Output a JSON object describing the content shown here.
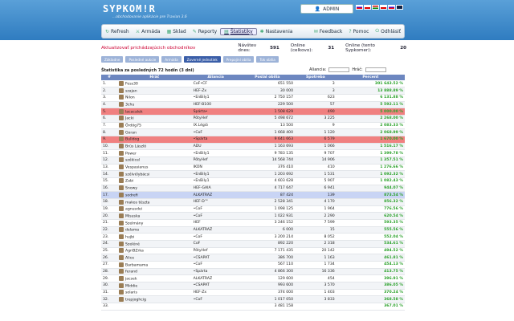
{
  "app": {
    "logo": "SYPKOM!R",
    "tagline": "...obchodovanie aplikácie pre Travian 3.6",
    "user": "ADMIN"
  },
  "nav": [
    {
      "label": "Refresh",
      "icon": "refresh-icon",
      "active": false
    },
    {
      "label": "Armáda",
      "icon": "army-icon",
      "active": false
    },
    {
      "label": "Sklad",
      "icon": "warehouse-icon",
      "active": false
    },
    {
      "label": "Reporty",
      "icon": "report-icon",
      "active": false
    },
    {
      "label": "Štatistiky",
      "icon": "stats-icon",
      "active": true
    },
    {
      "label": "Nastavenia",
      "icon": "settings-icon",
      "active": false
    }
  ],
  "nav_right": [
    {
      "label": "Feedback",
      "icon": "feedback-icon"
    },
    {
      "label": "Pomoc",
      "icon": "help-icon"
    },
    {
      "label": "Odhlásiť",
      "icon": "logout-icon"
    }
  ],
  "info": {
    "alert": "Aktualizovať prichádzajúcich obchodníkov",
    "visits_label": "Návštev dnes:",
    "visits": "591",
    "online_label": "Online (celkovo):",
    "online": "31",
    "online_sk_label": "Online (tento Sypkomer):",
    "online_sk": "20"
  },
  "tabs": [
    "Základne",
    "Posledné aukcie",
    "Armáda",
    "Zoverné jednotiek",
    "Prepojiní obilia",
    "Tok obilia"
  ],
  "active_tab": 3,
  "table": {
    "title": "Štatistika za posledných 72 hodín (3 dni)",
    "alliance_label": "Aliancia:",
    "player_label": "Hráč:",
    "headers": [
      "#",
      "Hráč",
      "Aliancia",
      "Poslal obilia",
      "Spotreba",
      "Percent"
    ],
    "rows": [
      [
        "1.",
        "Fess30",
        "CoF•CF",
        "651 550",
        "3",
        "301 643.52 %",
        ""
      ],
      [
        "2.",
        "szajan",
        "HEF-Zx",
        "30 000",
        "3",
        "13 888.89 %",
        ""
      ],
      [
        "3.",
        "Nilon",
        "•EnBily1",
        "2 750 157",
        "623",
        "6 131.88 %",
        ""
      ],
      [
        "4.",
        "3chu",
        "HEF-B100",
        "229 500",
        "57",
        "5 592.11 %",
        ""
      ],
      [
        "5.",
        "lacacalek",
        "Spárta•",
        "1 508 629",
        "490",
        "5 000.00 %",
        "red"
      ],
      [
        "6.",
        "Jacki",
        "PötyHef",
        "5 498 672",
        "3 225",
        "2 268.00 %",
        ""
      ],
      [
        "7.",
        "Ördög75",
        "IX.Légió",
        "13 500",
        "9",
        "2 083.33 %",
        ""
      ],
      [
        "8.",
        "Goran",
        "•CoF",
        "1 668 400",
        "1 120",
        "2 068.99 %",
        ""
      ],
      [
        "9.",
        "Bulldog",
        "•Spárta",
        "9 641 663",
        "6 579",
        "1 670.00 %",
        "red"
      ],
      [
        "10.",
        "Brüs László",
        "ADU",
        "1 163 693",
        "1 066",
        "1 516.17 %",
        ""
      ],
      [
        "11.",
        "Power",
        "•EnBily1",
        "9 783 135",
        "9 707",
        "1 399.78 %",
        ""
      ],
      [
        "12.",
        "székicel",
        "PötyHef",
        "14 568 744",
        "14 906",
        "1 357.51 %",
        ""
      ],
      [
        "13.",
        "Vespasianus",
        "IKON",
        "376 410",
        "410",
        "1 276.66 %",
        ""
      ],
      [
        "14.",
        "szélvélybácsi",
        "•EnBily1",
        "1 203 692",
        "1 531",
        "1 092.32 %",
        ""
      ],
      [
        "15.",
        "Zabi",
        "•EnBily1",
        "4 603 628",
        "5 907",
        "1 082.43 %",
        ""
      ],
      [
        "16.",
        "Snowy",
        "HEF-GAIA",
        "4 717 647",
        "6 941",
        "944.07 %",
        ""
      ],
      [
        "17.",
        "sodrefi",
        "ALKATRAZ",
        "87 424",
        "139",
        "873.54 %",
        "blue"
      ],
      [
        "18.",
        "makos tészta",
        "HEF-D™",
        "2 528 341",
        "4 170",
        "856.32 %",
        ""
      ],
      [
        "19.",
        "agnusdei",
        "•CoF",
        "1 098 125",
        "1 964",
        "776.56 %",
        ""
      ],
      [
        "20.",
        "Misuska",
        "•CoF",
        "1 022 931",
        "2 290",
        "620.54 %",
        ""
      ],
      [
        "21.",
        "Szelmány",
        "HEF",
        "3 246 152",
        "7 599",
        "593.35 %",
        ""
      ],
      [
        "22.",
        "delama",
        "ALKATRAZ",
        "6 000",
        "15",
        "555.56 %",
        ""
      ],
      [
        "23.",
        "hujbi",
        "•CoF",
        "3 200 214",
        "8 052",
        "552.04 %",
        ""
      ],
      [
        "24.",
        "Szeléné",
        "CoF",
        "892 220",
        "2 318",
        "534.61 %",
        ""
      ],
      [
        "25.",
        "AgriBZrka",
        "PötyHef",
        "7 171 435",
        "20 142",
        "494.52 %",
        ""
      ],
      [
        "26.",
        "Alice",
        "•CSAPAT",
        "386 700",
        "1 163",
        "461.81 %",
        ""
      ],
      [
        "27.",
        "Barbamama",
        "•CoF",
        "567 110",
        "1 734",
        "454.13 %",
        ""
      ],
      [
        "28.",
        "ferand",
        "•Spárta",
        "4 866 300",
        "16 336",
        "413.75 %",
        ""
      ],
      [
        "29.",
        "jacsek",
        "ALKATRAZ",
        "129 600",
        "454",
        "396.91 %",
        ""
      ],
      [
        "30.",
        "Middie",
        "•CSAPAT",
        "993 600",
        "3 570",
        "386.05 %",
        ""
      ],
      [
        "31.",
        "solaris",
        "HEF-Zx",
        "374 000",
        "1 403",
        "370.24 %",
        ""
      ],
      [
        "32.",
        "trepjoghcig",
        "•CoF",
        "1 017 050",
        "3 833",
        "368.58 %",
        ""
      ],
      [
        "33.",
        "",
        "",
        "3 481 158",
        "",
        "367.01 %",
        ""
      ]
    ]
  },
  "colors": {
    "header": "#2f7cc0",
    "tab": "#9db3d8",
    "tab_active": "#3a5ea8",
    "th": "#6d87c0",
    "pct": "#2aa12a",
    "red_row": "#f08080",
    "blue_row": "#c8d4f4"
  }
}
